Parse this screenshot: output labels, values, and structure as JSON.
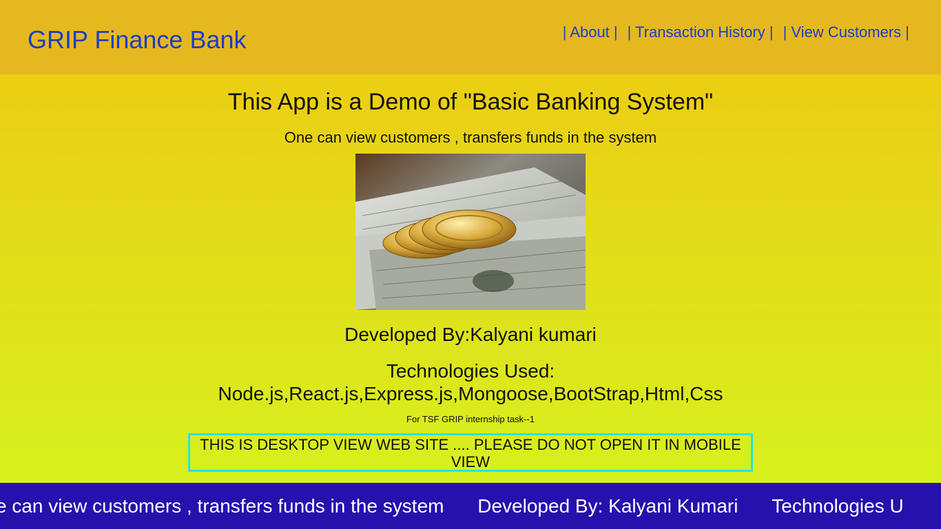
{
  "navbar": {
    "brand": "GRIP Finance Bank",
    "links": [
      "| About |",
      "| Transaction History |",
      "| View Customers |"
    ]
  },
  "main": {
    "title": "This App is a Demo of \"Basic Banking System\"",
    "subtitle": "One can view customers , transfers funds in the system",
    "developer": "Developed By:Kalyani kumari",
    "tech_label": "Technologies Used:",
    "tech_list": "Node.js,React.js,Express.js,Mongoose,BootStrap,Html,Css",
    "task_note": "For TSF GRIP internship task--1",
    "warning": "THIS IS DESKTOP VIEW WEB SITE .... PLEASE DO NOT OPEN IT IN MOBILE VIEW"
  },
  "ticker": {
    "items": [
      "e can view customers , transfers funds in the system",
      "Developed By: Kalyani Kumari",
      "Technologies U"
    ]
  }
}
